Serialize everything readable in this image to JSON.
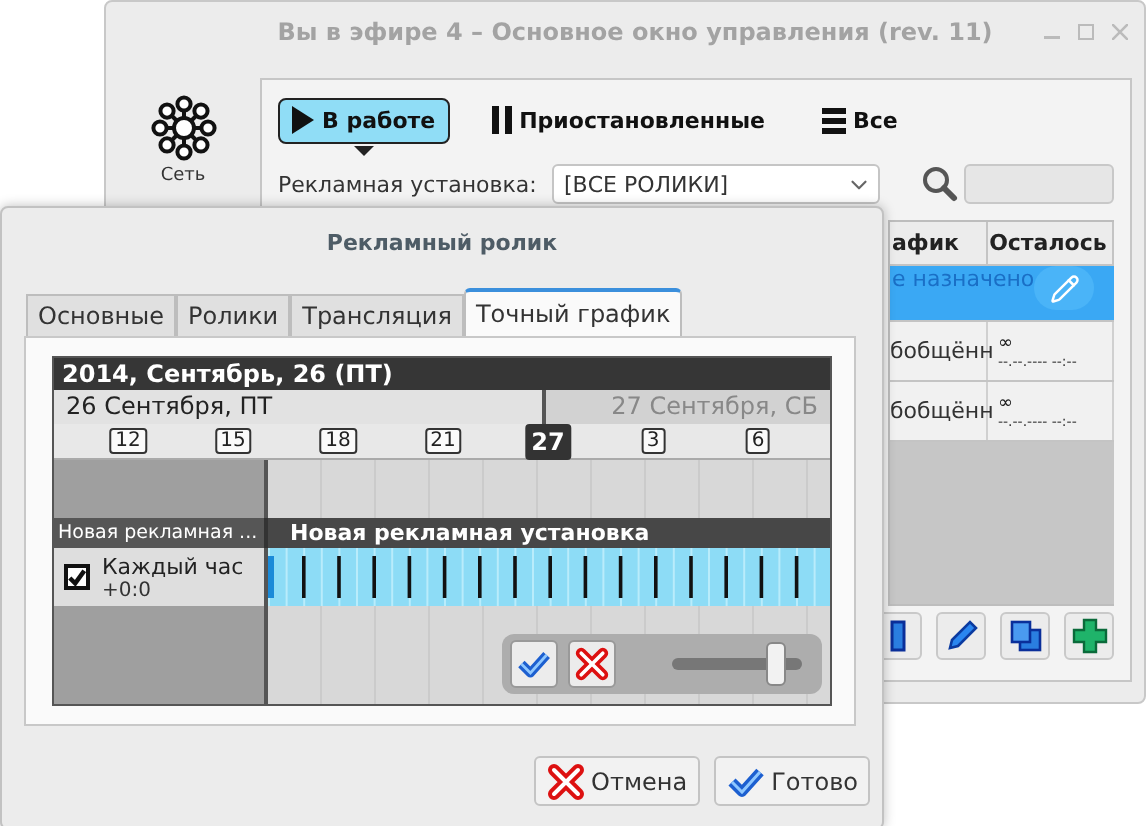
{
  "main_window": {
    "title": "Вы в эфире 4 – Основное окно управления (rev. 11)",
    "sidebar": [
      {
        "label": "Сеть",
        "selected": false
      }
    ],
    "filters": [
      {
        "label": "В работе",
        "kind": "play",
        "selected": true
      },
      {
        "label": "Приостановленные",
        "kind": "pause",
        "selected": false
      },
      {
        "label": "Все",
        "kind": "list",
        "selected": false
      }
    ],
    "ad_setup": {
      "label": "Рекламная установка:",
      "value": "[ВСЕ РОЛИКИ]"
    },
    "table": {
      "columns": [
        "афик",
        "Осталось"
      ],
      "rows": [
        {
          "schedule": "е назначено",
          "selected": true
        },
        {
          "schedule": "бобщённ",
          "remaining": "∞",
          "remaining_time": "--.--.---- --:--",
          "selected": false
        },
        {
          "schedule": "бобщённ",
          "remaining": "∞",
          "remaining_time": "--.--.---- --:--",
          "selected": false
        }
      ]
    },
    "toolbar": [
      {
        "kind": "panel"
      },
      {
        "kind": "edit"
      },
      {
        "kind": "copy"
      },
      {
        "kind": "add"
      }
    ]
  },
  "dialog": {
    "title": "Рекламный ролик",
    "tabs": [
      {
        "label": "Основные",
        "selected": false
      },
      {
        "label": "Ролики",
        "selected": false
      },
      {
        "label": "Трансляция",
        "selected": false
      },
      {
        "label": "Точный график",
        "selected": true
      }
    ],
    "schedule": {
      "day_title": "2014, Сентябрь, 26 (ПТ)",
      "day_label": "26 Сентября, ПТ",
      "next_day_label": "27 Сентября, СБ",
      "hours": [
        {
          "label": "12",
          "selected": false
        },
        {
          "label": "15",
          "selected": false
        },
        {
          "label": "18",
          "selected": false
        },
        {
          "label": "21",
          "selected": false
        },
        {
          "label": "27",
          "selected": true
        },
        {
          "label": "3",
          "selected": false
        },
        {
          "label": "6",
          "selected": false
        }
      ],
      "group_short": "Новая рекламная ...",
      "group": "Новая рекламная установка",
      "rows": [
        {
          "label": "Каждый час",
          "offset": "+0:0",
          "checked": true
        }
      ],
      "zoom": {
        "level": 0.8
      }
    },
    "buttons": [
      {
        "label": "Отмена",
        "kind": "cancel"
      },
      {
        "label": "Готово",
        "kind": "ok"
      }
    ]
  }
}
